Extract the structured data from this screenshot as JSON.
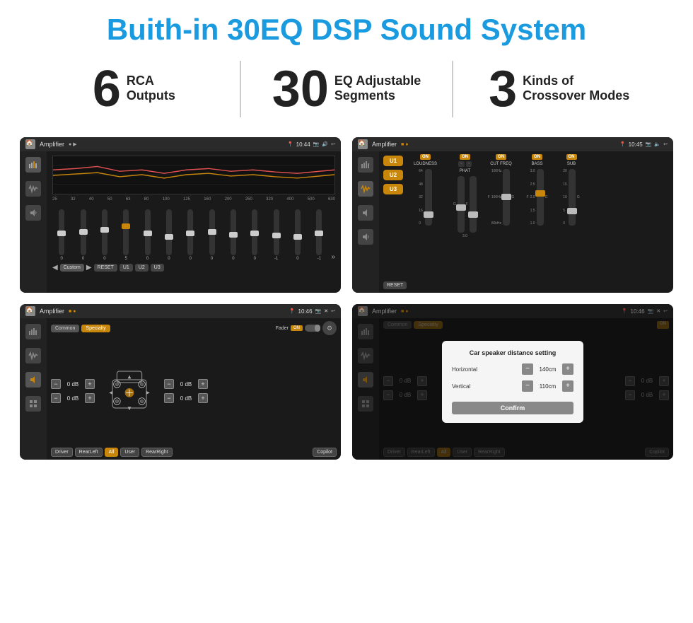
{
  "title": "Buith-in 30EQ DSP Sound System",
  "stats": [
    {
      "number": "6",
      "line1": "RCA",
      "line2": "Outputs"
    },
    {
      "number": "30",
      "line1": "EQ Adjustable",
      "line2": "Segments"
    },
    {
      "number": "3",
      "line1": "Kinds of",
      "line2": "Crossover Modes"
    }
  ],
  "screens": [
    {
      "id": "eq-screen",
      "statusBar": {
        "appTitle": "Amplifier",
        "time": "10:44"
      },
      "type": "eq"
    },
    {
      "id": "amp-screen",
      "statusBar": {
        "appTitle": "Amplifier",
        "time": "10:45"
      },
      "type": "amp"
    },
    {
      "id": "speaker-screen",
      "statusBar": {
        "appTitle": "Amplifier",
        "time": "10:46"
      },
      "type": "speaker"
    },
    {
      "id": "speaker-dialog-screen",
      "statusBar": {
        "appTitle": "Amplifier",
        "time": "10:46"
      },
      "type": "speaker-dialog"
    }
  ],
  "eqScreen": {
    "freqLabels": [
      "25",
      "32",
      "40",
      "50",
      "63",
      "80",
      "100",
      "125",
      "160",
      "200",
      "250",
      "320",
      "400",
      "500",
      "630"
    ],
    "sliderValues": [
      "0",
      "0",
      "0",
      "5",
      "0",
      "0",
      "0",
      "0",
      "0",
      "0",
      "-1",
      "0",
      "-1"
    ],
    "buttons": [
      "Custom",
      "RESET",
      "U1",
      "U2",
      "U3"
    ],
    "preset": "Custom"
  },
  "ampScreen": {
    "presets": [
      "U1",
      "U2",
      "U3"
    ],
    "channels": [
      {
        "name": "LOUDNESS",
        "on": true
      },
      {
        "name": "PHAT",
        "on": true
      },
      {
        "name": "CUT FREQ",
        "on": true
      },
      {
        "name": "BASS",
        "on": true
      },
      {
        "name": "SUB",
        "on": true
      }
    ],
    "resetBtn": "RESET"
  },
  "speakerScreen": {
    "tabs": [
      "Common",
      "Specialty"
    ],
    "activeTab": "Specialty",
    "faderLabel": "Fader",
    "faderOn": "ON",
    "dbValues": [
      "0 dB",
      "0 dB",
      "0 dB",
      "0 dB"
    ],
    "buttons": [
      "Driver",
      "RearLeft",
      "All",
      "User",
      "RearRight",
      "Copilot"
    ]
  },
  "speakerDialogScreen": {
    "tabs": [
      "Common",
      "Specialty"
    ],
    "dialogTitle": "Car speaker distance setting",
    "horizontal": {
      "label": "Horizontal",
      "value": "140cm"
    },
    "vertical": {
      "label": "Vertical",
      "value": "110cm"
    },
    "confirmBtn": "Confirm",
    "dbValues": [
      "0 dB",
      "0 dB"
    ],
    "buttons": [
      "Driver",
      "RearLeft",
      "All",
      "User",
      "RearRight",
      "Copilot"
    ]
  }
}
